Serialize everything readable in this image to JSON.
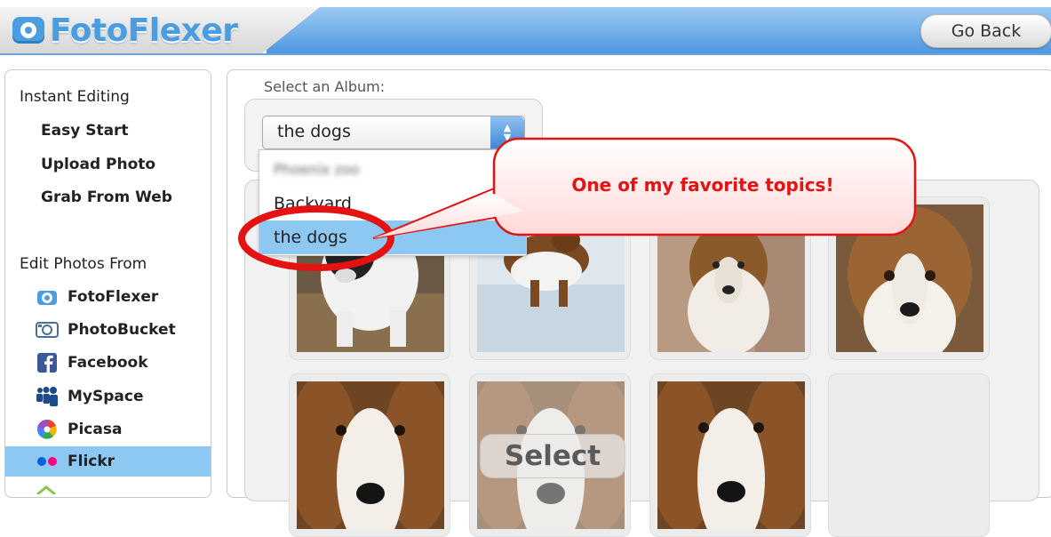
{
  "app": {
    "logo_text": "FotoFlexer"
  },
  "header": {
    "go_back_label": "Go Back"
  },
  "sidebar": {
    "instant_heading": "Instant Editing",
    "instant_items": [
      "Easy Start",
      "Upload Photo",
      "Grab From Web"
    ],
    "edit_heading": "Edit Photos From",
    "sources": [
      {
        "label": "FotoFlexer",
        "icon": "fotoflexer-camera-icon"
      },
      {
        "label": "PhotoBucket",
        "icon": "photobucket-icon"
      },
      {
        "label": "Facebook",
        "icon": "facebook-icon"
      },
      {
        "label": "MySpace",
        "icon": "myspace-icon"
      },
      {
        "label": "Picasa",
        "icon": "picasa-icon"
      },
      {
        "label": "Flickr",
        "icon": "flickr-icon",
        "active": true
      }
    ]
  },
  "album": {
    "label": "Select an Album:",
    "selected": "the dogs",
    "options": [
      "Phoenix zoo",
      "Backyard",
      "the dogs"
    ]
  },
  "callout": {
    "text": "One of my favorite topics!"
  },
  "grid": {
    "select_label": "Select"
  },
  "colors": {
    "accent_blue": "#4a9de0",
    "callout_red": "#e41212",
    "highlight": "#8cc8f2"
  }
}
